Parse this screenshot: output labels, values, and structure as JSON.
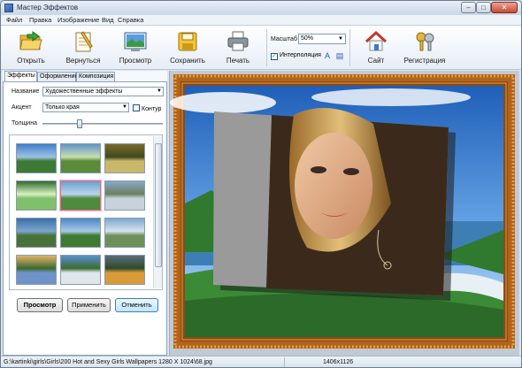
{
  "window": {
    "title": "Мастер Эффектов"
  },
  "window_controls": {
    "minimize": "–",
    "maximize": "□",
    "close": "✕"
  },
  "menu": [
    "Файл",
    "Правка",
    "Изображение",
    "Вид",
    "Справка"
  ],
  "toolbar": {
    "buttons": [
      {
        "label": "Открыть",
        "icon": "folder-open-icon"
      },
      {
        "label": "Вернуться",
        "icon": "undo-notepad-icon"
      },
      {
        "label": "Просмотр",
        "icon": "preview-picture-icon"
      },
      {
        "label": "Сохранить",
        "icon": "floppy-save-icon"
      },
      {
        "label": "Печать",
        "icon": "printer-icon"
      },
      {
        "label": "Сайт",
        "icon": "home-icon"
      },
      {
        "label": "Регистрация",
        "icon": "keys-icon"
      }
    ],
    "zoom_label": "Масштаб",
    "zoom_value": "50%",
    "interpolation_label": "Интерполяция",
    "interpolation_checked": true
  },
  "panel": {
    "tabs": [
      "Эффекты",
      "Оформление",
      "Композиция"
    ],
    "active_tab": 0,
    "name_label": "Название",
    "name_value": "Художественные эффекты",
    "accent_label": "Акцент",
    "accent_value": "Только края",
    "contour_label": "Контур",
    "contour_checked": false,
    "thickness_label": "Толщина",
    "thickness_level": 0.3,
    "selected_thumb": 4,
    "buttons": {
      "preview": "Просмотр",
      "apply": "Применить",
      "cancel": "Отменить"
    }
  },
  "status": {
    "path": "G:\\kartinki\\girls\\Girls\\200 Hot and Sexy Girls Wallpapers 1280 X 1024\\68.jpg",
    "dimensions": "1406x1126"
  },
  "colors": {
    "frame_wood": "#b5621a",
    "frame_gold": "#e0a14a",
    "sky": "#4a8fd8",
    "grass": "#2f7a2e",
    "sea": "#3d7fb5"
  }
}
